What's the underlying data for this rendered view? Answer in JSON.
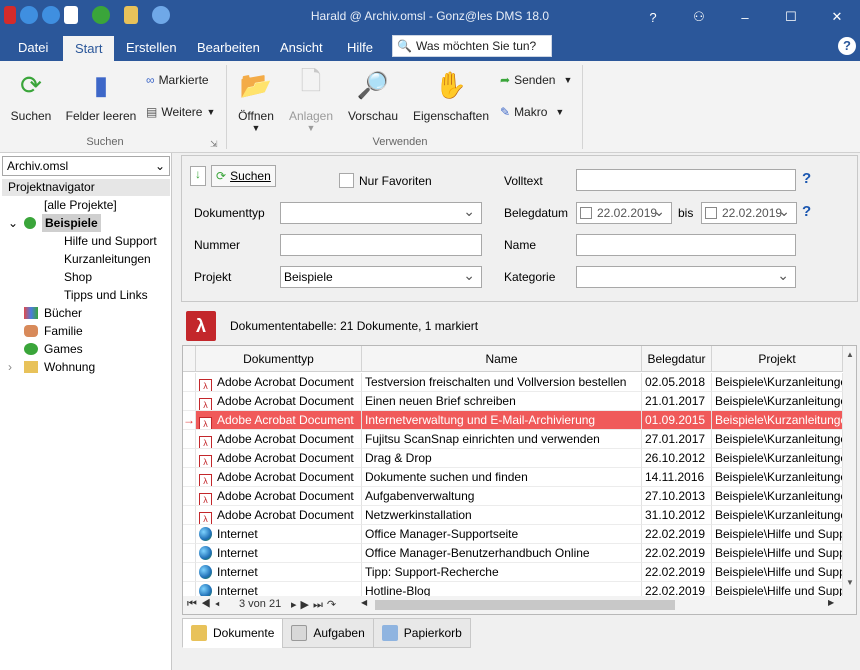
{
  "window": {
    "title": "Harald @ Archiv.omsl - Gonz@les DMS 18.0",
    "minimize": "–",
    "maximize": "☐",
    "close": "✕",
    "help_btn": "?",
    "pin_btn": "⚇"
  },
  "menu": {
    "tabs": [
      "Datei",
      "Start",
      "Erstellen",
      "Bearbeiten",
      "Ansicht",
      "Hilfe"
    ],
    "active": "Start",
    "search_placeholder": "Was möchten Sie tun?",
    "help": "?"
  },
  "ribbon": {
    "suchen": "Suchen",
    "felder_leeren": "Felder leeren",
    "markierte": "Markierte",
    "weitere": "Weitere",
    "group_suchen": "Suchen",
    "oeffnen": "Öffnen",
    "anlagen": "Anlagen",
    "vorschau": "Vorschau",
    "eigenschaften": "Eigenschaften",
    "senden": "Senden",
    "makro": "Makro",
    "group_verwenden": "Verwenden"
  },
  "left": {
    "archive": "Archiv.omsl",
    "navigator_title": "Projektnavigator",
    "tree": [
      "[alle Projekte]",
      "Beispiele",
      "Hilfe und Support",
      "Kurzanleitungen",
      "Shop",
      "Tipps und Links",
      "Bücher",
      "Familie",
      "Games",
      "Wohnung"
    ]
  },
  "filter": {
    "search_btn": "Suchen",
    "favoriten": "Nur Favoriten",
    "volltext": "Volltext",
    "dokumenttyp": "Dokumenttyp",
    "belegdatum": "Belegdatum",
    "date_from": "22.02.2019",
    "bis": "bis",
    "date_to": "22.02.2019",
    "nummer": "Nummer",
    "name": "Name",
    "projekt": "Projekt",
    "projekt_value": "Beispiele",
    "kategorie": "Kategorie"
  },
  "table": {
    "info": "Dokumententabelle:  21 Dokumente, 1 markiert",
    "columns": [
      "Dokumenttyp",
      "Name",
      "Belegdatur",
      "Projekt"
    ],
    "rows": [
      {
        "type": "Adobe Acrobat Document",
        "name": "Testversion freischalten und Vollversion bestellen",
        "date": "02.05.2018",
        "project": "Beispiele\\Kurzanleitungen"
      },
      {
        "type": "Adobe Acrobat Document",
        "name": "Einen neuen Brief schreiben",
        "date": "21.01.2017",
        "project": "Beispiele\\Kurzanleitungen"
      },
      {
        "type": "Adobe Acrobat Document",
        "name": "Internetverwaltung und E-Mail-Archivierung",
        "date": "01.09.2015",
        "project": "Beispiele\\Kurzanleitungen"
      },
      {
        "type": "Adobe Acrobat Document",
        "name": "Fujitsu ScanSnap einrichten und verwenden",
        "date": "27.01.2017",
        "project": "Beispiele\\Kurzanleitungen"
      },
      {
        "type": "Adobe Acrobat Document",
        "name": "Drag & Drop",
        "date": "26.10.2012",
        "project": "Beispiele\\Kurzanleitungen"
      },
      {
        "type": "Adobe Acrobat Document",
        "name": "Dokumente suchen und finden",
        "date": "14.11.2016",
        "project": "Beispiele\\Kurzanleitungen"
      },
      {
        "type": "Adobe Acrobat Document",
        "name": "Aufgabenverwaltung",
        "date": "27.10.2013",
        "project": "Beispiele\\Kurzanleitungen"
      },
      {
        "type": "Adobe Acrobat Document",
        "name": "Netzwerkinstallation",
        "date": "31.10.2012",
        "project": "Beispiele\\Kurzanleitungen"
      },
      {
        "type": "Internet",
        "name": "Office Manager-Supportseite",
        "date": "22.02.2019",
        "project": "Beispiele\\Hilfe und Support"
      },
      {
        "type": "Internet",
        "name": "Office Manager-Benutzerhandbuch Online",
        "date": "22.02.2019",
        "project": "Beispiele\\Hilfe und Support"
      },
      {
        "type": "Internet",
        "name": "Tipp: Support-Recherche",
        "date": "22.02.2019",
        "project": "Beispiele\\Hilfe und Support"
      },
      {
        "type": "Internet",
        "name": "Hotline-Blog",
        "date": "22.02.2019",
        "project": "Beispiele\\Hilfe und Support"
      }
    ],
    "selected_index": 2,
    "pager": "3 von 21"
  },
  "tabs": [
    "Dokumente",
    "Aufgaben",
    "Papierkorb"
  ],
  "colors": {
    "accent": "#2b579a",
    "selection": "#f05a5a",
    "pdf": "#c3272b"
  }
}
